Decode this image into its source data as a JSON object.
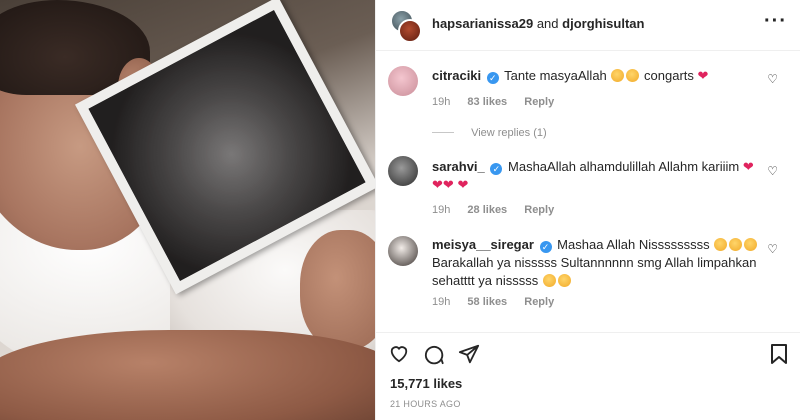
{
  "header": {
    "user1": "hapsarianissa29",
    "joiner": "and",
    "user2": "djorghisultan",
    "more_icon": "more-horizontal-icon"
  },
  "comments": [
    {
      "user": "citraciki",
      "text": "Tante masyaAllah",
      "text_after": "congarts",
      "time": "19h",
      "likes": "83 likes",
      "reply": "Reply",
      "view_replies": "View replies (1)"
    },
    {
      "user": "sarahvi_",
      "text": "MashaAllah alhamdulillah Allahm kariiim",
      "time": "19h",
      "likes": "28 likes",
      "reply": "Reply"
    },
    {
      "user": "meisya__siregar",
      "text": "Mashaa Allah Nisssssssss",
      "text_line2": "Barakallah ya nisssss Sultannnnnn smg Allah limpahkan",
      "text_line3": "sehatttt ya nisssss",
      "time": "19h",
      "likes": "58 likes",
      "reply": "Reply"
    }
  ],
  "footer": {
    "likes": "15,771 likes",
    "time": "21 HOURS AGO"
  },
  "colors": {
    "verified": "#3897f0",
    "heart": "#e0245e",
    "muted": "#8e8e8e"
  }
}
